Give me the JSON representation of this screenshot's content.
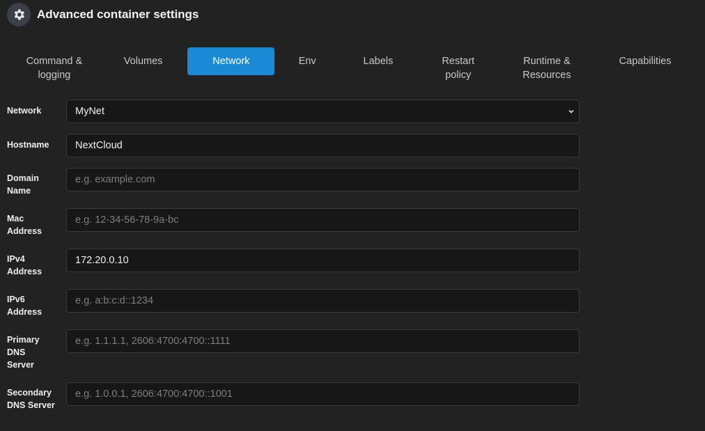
{
  "header": {
    "title": "Advanced container settings",
    "icon": "gear-icon"
  },
  "tabs": [
    {
      "label": "Command & logging",
      "active": false
    },
    {
      "label": "Volumes",
      "active": false
    },
    {
      "label": "Network",
      "active": true
    },
    {
      "label": "Env",
      "active": false
    },
    {
      "label": "Labels",
      "active": false
    },
    {
      "label": "Restart policy",
      "active": false
    },
    {
      "label": "Runtime & Resources",
      "active": false
    },
    {
      "label": "Capabilities",
      "active": false
    }
  ],
  "form": {
    "network": {
      "label": "Network",
      "value": "MyNet"
    },
    "hostname": {
      "label": "Hostname",
      "value": "NextCloud",
      "placeholder": ""
    },
    "domain": {
      "label": "Domain Name",
      "value": "",
      "placeholder": "e.g. example.com"
    },
    "mac": {
      "label": "Mac Address",
      "value": "",
      "placeholder": "e.g. 12-34-56-78-9a-bc"
    },
    "ipv4": {
      "label": "IPv4 Address",
      "value": "172.20.0.10",
      "placeholder": ""
    },
    "ipv6": {
      "label": "IPv6 Address",
      "value": "",
      "placeholder": "e.g. a:b:c:d::1234"
    },
    "dns1": {
      "label": "Primary DNS Server",
      "value": "",
      "placeholder": "e.g. 1.1.1.1, 2606:4700:4700::1111"
    },
    "dns2": {
      "label": "Secondary DNS Server",
      "value": "",
      "placeholder": "e.g. 1.0.0.1, 2606:4700:4700::1001"
    }
  },
  "colors": {
    "accent": "#1a8ad6",
    "background": "#222222",
    "field": "#171717"
  }
}
